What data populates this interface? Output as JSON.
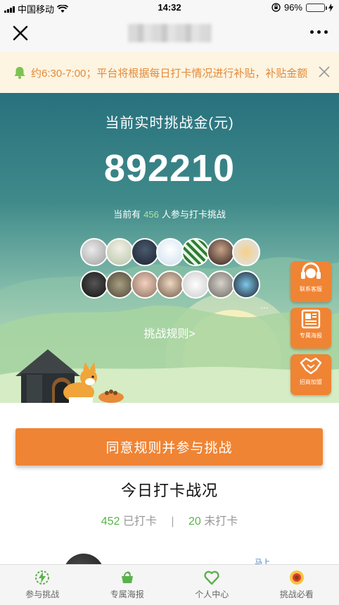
{
  "status_bar": {
    "carrier": "中国移动",
    "time": "14:32",
    "battery": "96%"
  },
  "nav": {
    "close_icon": "close-icon",
    "more_icon": "more-dots-icon"
  },
  "notice": {
    "text": "约6:30-7:00；平台将根据每日打卡情况进行补贴，补贴金额"
  },
  "hero": {
    "title": "当前实时挑战金(元)",
    "amount": "892210",
    "participants_prefix": "当前有",
    "participants_count": "456",
    "participants_suffix": "人参与打卡挑战",
    "more_dots": "...",
    "rules_link": "挑战规则>"
  },
  "side_buttons": {
    "service": "联系客服",
    "poster": "专属海报",
    "partner": "招商加盟"
  },
  "action": {
    "join_label": "同意规则并参与挑战"
  },
  "today": {
    "title": "今日打卡战况",
    "checked_count": "452",
    "checked_label": "已打卡",
    "separator": "|",
    "unchecked_count": "20",
    "unchecked_label": "未打卡"
  },
  "peek": {
    "tag": "马上"
  },
  "tabbar": {
    "items": [
      {
        "label": "参与挑战",
        "icon": "lightning-badge-icon"
      },
      {
        "label": "专属海报",
        "icon": "basket-icon"
      },
      {
        "label": "个人中心",
        "icon": "heart-icon"
      },
      {
        "label": "挑战必看",
        "icon": "sunflower-icon"
      }
    ]
  },
  "colors": {
    "accent": "#ef8434",
    "green": "#59b34b",
    "notice_text": "#e28a3a"
  }
}
